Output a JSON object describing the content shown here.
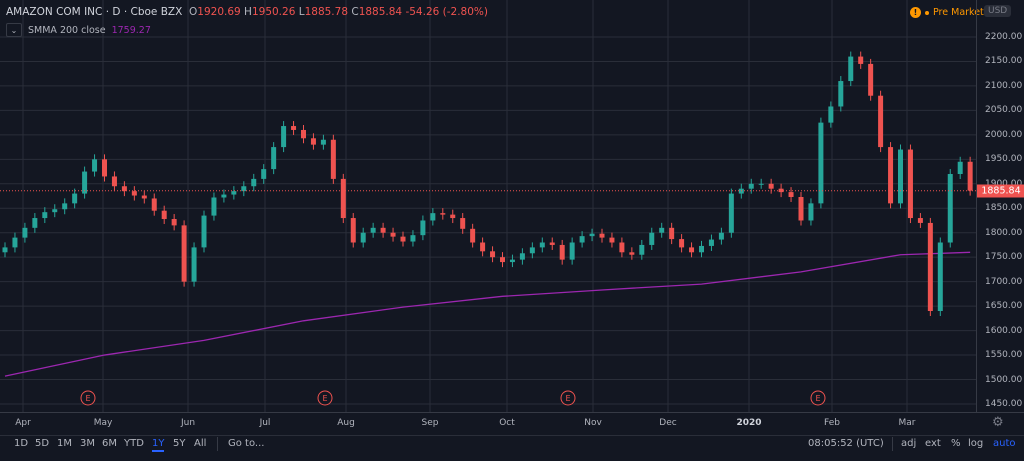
{
  "header": {
    "symbol": "AMAZON COM INC",
    "sep1": "·",
    "interval": "D",
    "sep2": "·",
    "exchange": "Cboe BZX",
    "o_label": "O",
    "o_value": "1920.69",
    "h_label": "H",
    "h_value": "1950.26",
    "l_label": "L",
    "l_value": "1885.78",
    "c_label": "C",
    "c_value": "1885.84",
    "change": "-54.26 (-2.80%)",
    "indicator_name": "SMMA",
    "indicator_params": "200 close",
    "indicator_value": "1759.27",
    "market_status": "Pre Market",
    "currency": "USD"
  },
  "colors": {
    "background": "#131722",
    "up": "#26a69a",
    "down": "#ef5350",
    "smma": "#9c27b0",
    "accent": "#2962ff",
    "premarket": "#ff9800"
  },
  "chart_data": {
    "type": "candlestick",
    "price_ticks": [
      "2200.00",
      "2150.00",
      "2100.00",
      "2050.00",
      "2000.00",
      "1950.00",
      "1900.00",
      "1850.00",
      "1800.00",
      "1750.00",
      "1700.00",
      "1650.00",
      "1600.00",
      "1550.00",
      "1500.00",
      "1450.00"
    ],
    "ylim": [
      1450,
      2200
    ],
    "x_ticks": [
      "Apr",
      "May",
      "Jun",
      "Jul",
      "Aug",
      "Sep",
      "Oct",
      "Nov",
      "Dec",
      "2020",
      "Feb",
      "Mar"
    ],
    "current_price": "1885.84",
    "closes": [
      1770,
      1790,
      1810,
      1830,
      1842,
      1848,
      1860,
      1880,
      1925,
      1950,
      1915,
      1895,
      1885,
      1876,
      1870,
      1845,
      1828,
      1815,
      1700,
      1770,
      1835,
      1872,
      1878,
      1885,
      1895,
      1910,
      1930,
      1975,
      2018,
      2010,
      1993,
      1980,
      1990,
      1910,
      1830,
      1780,
      1800,
      1810,
      1800,
      1792,
      1782,
      1795,
      1825,
      1840,
      1837,
      1830,
      1808,
      1780,
      1762,
      1750,
      1740,
      1745,
      1758,
      1770,
      1780,
      1775,
      1745,
      1780,
      1793,
      1798,
      1790,
      1780,
      1760,
      1755,
      1775,
      1800,
      1810,
      1787,
      1770,
      1760,
      1773,
      1786,
      1800,
      1880,
      1890,
      1900,
      1900,
      1890,
      1883,
      1873,
      1825,
      1860,
      2025,
      2058,
      2110,
      2160,
      2145,
      2080,
      1975,
      1860,
      1970,
      1830,
      1820,
      1640,
      1780,
      1920,
      1945,
      1886
    ],
    "smma": [
      1507,
      1550,
      1580,
      1620,
      1648,
      1670,
      1683,
      1695,
      1720,
      1755,
      1760
    ],
    "earnings_marker": "E",
    "grid": true
  },
  "toolbar": {
    "ranges": [
      "1D",
      "5D",
      "1M",
      "3M",
      "6M",
      "YTD",
      "1Y",
      "5Y",
      "All"
    ],
    "active_range": "1Y",
    "goto": "Go to...",
    "time": "08:05:52 (UTC)",
    "adj": "adj",
    "ext": "ext",
    "percent": "%",
    "log": "log",
    "auto": "auto"
  }
}
